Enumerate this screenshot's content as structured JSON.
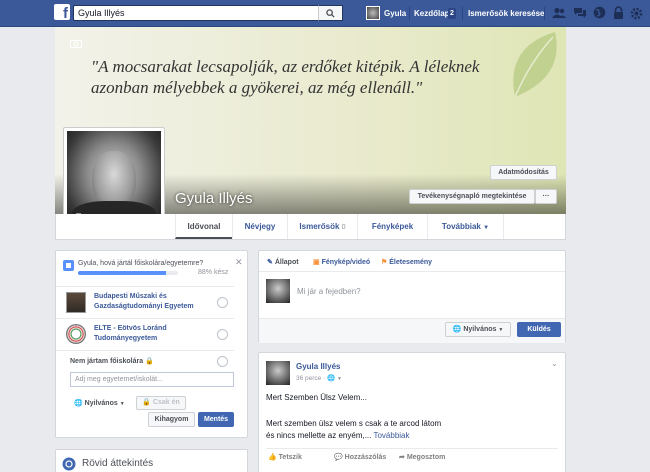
{
  "topbar": {
    "search_value": "Gyula Illyés",
    "user_name": "Gyula",
    "home_label": "Kezdőlap",
    "home_count": "2",
    "find_friends": "Ismerősök keresése"
  },
  "cover": {
    "quote": "\"A mocsarakat lecsapolják, az erdőket kitépik. A léleknek azonban mélyebbek a gyökerei, az még ellenáll.\"",
    "update_info": "Adatmódosítás",
    "activity_log": "Tevékenységnapló megtekintése",
    "more_dots": "···"
  },
  "profile": {
    "name": "Gyula Illyés"
  },
  "tabs": [
    {
      "label": "Idővonal"
    },
    {
      "label": "Névjegy"
    },
    {
      "label": "Ismerősök",
      "count": "0"
    },
    {
      "label": "Fényképek"
    },
    {
      "label": "Továbbiak"
    }
  ],
  "school_card": {
    "question": "Gyula, hová jártál főiskolára/egyetemre?",
    "progress_text": "88% kész",
    "progress": 0.88,
    "options": [
      {
        "name": "Budapesti Műszaki és Gazdaságtudományi Egyetem"
      },
      {
        "name": "ELTE - Eötvös Loránd Tudományegyetem"
      }
    ],
    "no_college": "Nem jártam főiskolára",
    "input_placeholder": "Adj meg egyetemet/iskolát...",
    "privacy": "Nyilvános",
    "only_me": "Csak én",
    "skip": "Kihagyom",
    "save": "Mentés"
  },
  "overview": {
    "title": "Rövid áttekintés"
  },
  "composer": {
    "status": "Állapot",
    "photo": "Fénykép/videó",
    "life_event": "Életesemény",
    "placeholder": "Mi jár a fejedben?",
    "privacy": "Nyilvános",
    "post": "Küldés"
  },
  "post": {
    "author": "Gyula Illyés",
    "time": "36 perce",
    "line1": "Mert Szemben Ülsz Velem...",
    "line2": "Mert szemben ülsz velem s csak a te arcod látom",
    "line3": "és nincs mellette az enyém,...",
    "more": "Továbbiak",
    "like": "Tetszik",
    "comment": "Hozzászólás",
    "share": "Megosztom"
  },
  "colors": {
    "topbar": "#3b5998",
    "link": "#3b5998",
    "button_blue": "#4267b2",
    "page_bg": "#e9eaed",
    "progress": "#5890ff"
  }
}
